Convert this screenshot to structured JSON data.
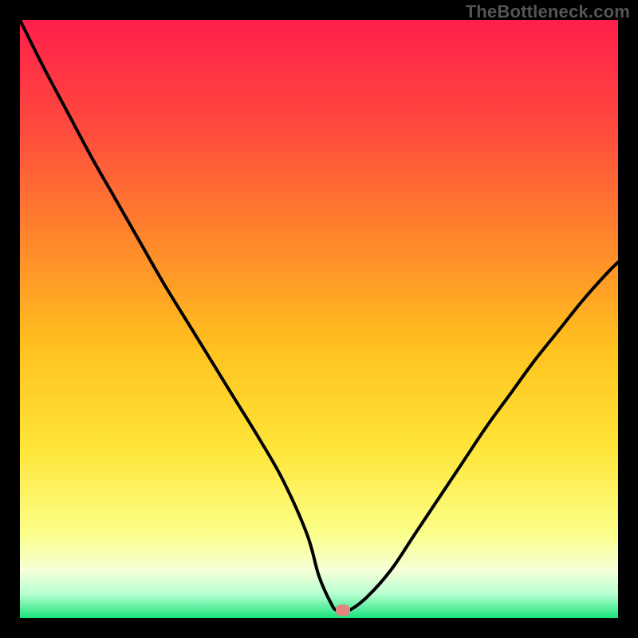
{
  "watermark": "TheBottleneck.com",
  "chart_data": {
    "type": "line",
    "title": "",
    "xlabel": "",
    "ylabel": "",
    "xlim": [
      0,
      100
    ],
    "ylim": [
      0,
      100
    ],
    "gradient_stops": [
      {
        "pos": 0.0,
        "color": "#ff1f4b"
      },
      {
        "pos": 0.18,
        "color": "#ff4a3e"
      },
      {
        "pos": 0.38,
        "color": "#ff8a2a"
      },
      {
        "pos": 0.55,
        "color": "#ffc21e"
      },
      {
        "pos": 0.72,
        "color": "#ffe63a"
      },
      {
        "pos": 0.86,
        "color": "#fbff8a"
      },
      {
        "pos": 0.92,
        "color": "#f6ffd8"
      },
      {
        "pos": 0.96,
        "color": "#b6ffd1"
      },
      {
        "pos": 1.0,
        "color": "#19e37a"
      }
    ],
    "series": [
      {
        "name": "curve",
        "x": [
          0,
          4,
          8,
          12,
          16,
          20,
          24,
          28,
          32,
          36,
          40,
          44,
          48,
          50,
          52,
          53,
          55,
          58,
          62,
          66,
          70,
          74,
          78,
          82,
          86,
          90,
          94,
          98,
          100
        ],
        "y": [
          100,
          92,
          84.5,
          77,
          70,
          63,
          56,
          49.5,
          43,
          36.5,
          30,
          23,
          14,
          7,
          2.5,
          1.3,
          1.3,
          3.5,
          8,
          14,
          20,
          26,
          32,
          37.5,
          43,
          48,
          53,
          57.5,
          59.5
        ]
      }
    ],
    "marker": {
      "x": 54,
      "y": 1.3,
      "color": "#e1857f"
    }
  }
}
